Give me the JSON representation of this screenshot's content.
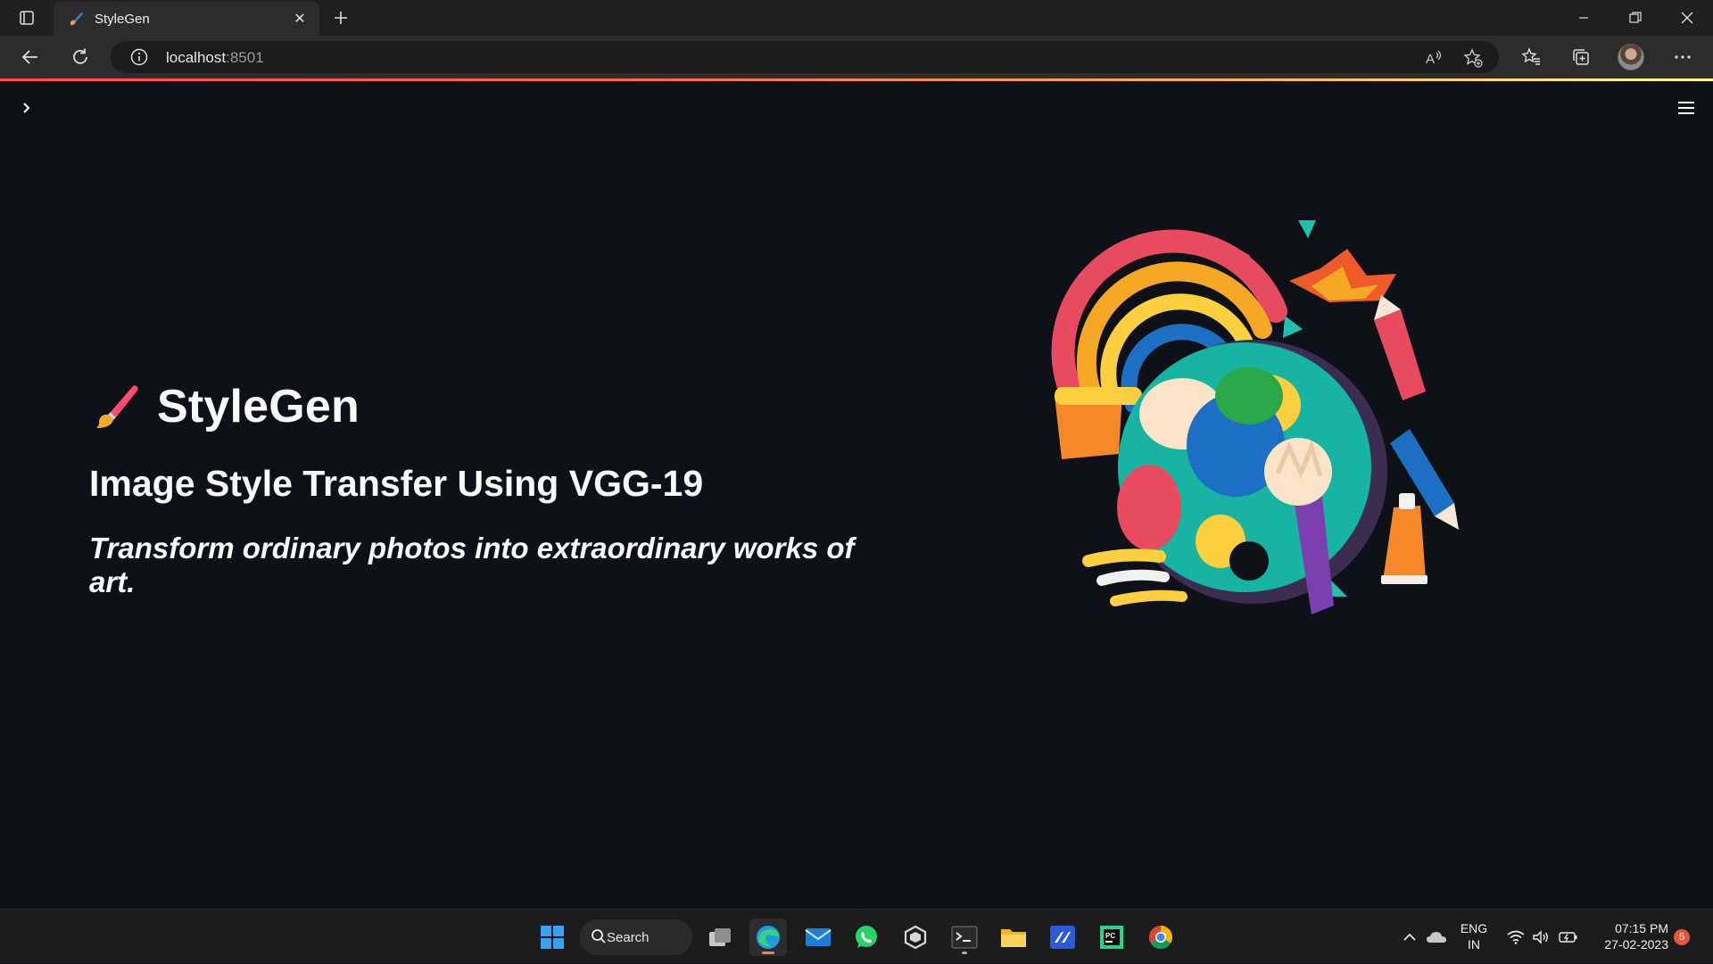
{
  "browser": {
    "tab": {
      "title": "StyleGen",
      "favicon": "paintbrush-icon"
    },
    "address": {
      "host": "localhost",
      "port": ":8501"
    },
    "accent_gradient": [
      "#ff4b4b",
      "#ffbd45",
      "#fffd80"
    ]
  },
  "page": {
    "brand_emoji": "paintbrush-icon",
    "title": "StyleGen",
    "subtitle": "Image Style Transfer Using VGG-19",
    "tagline": "Transform ordinary photos into extraordinary works of art.",
    "hero_image": "art-palette-illustration",
    "background": "#0e1117"
  },
  "taskbar": {
    "search_label": "Search",
    "pinned": [
      "windows-start-icon",
      "search-icon",
      "task-view-icon",
      "edge-icon",
      "mail-icon",
      "whatsapp-icon",
      "unity-icon",
      "terminal-icon",
      "file-explorer-icon",
      "visual-studio-icon",
      "pycharm-icon",
      "chrome-icon"
    ],
    "lang_line1": "ENG",
    "lang_line2": "IN",
    "time": "07:15 PM",
    "date": "27-02-2023",
    "notification_count": "5"
  }
}
